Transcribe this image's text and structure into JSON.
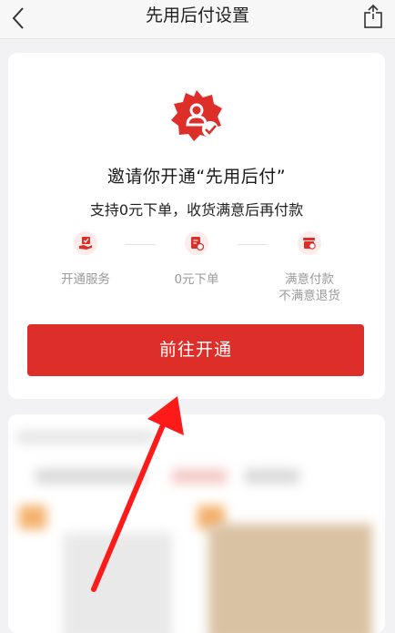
{
  "header": {
    "title": "先用后付设置",
    "back_icon": "chevron-left-icon",
    "share_icon": "share-icon"
  },
  "card": {
    "badge_icon": "user-verified-badge-icon",
    "headline": "邀请你开通“先用后付”",
    "subline": "支持0元下单，收货满意后再付款",
    "steps": [
      {
        "icon": "hand-check-icon",
        "label": "开通服务"
      },
      {
        "icon": "document-yuan-icon",
        "label": "0元下单"
      },
      {
        "icon": "wallet-yuan-icon",
        "label_line1": "满意付款",
        "label_line2": "不满意退货"
      }
    ],
    "cta_label": "前往开通"
  },
  "colors": {
    "accent": "#dd2e2a",
    "icon_bg": "#fdecea",
    "muted_text": "#9a9a9a",
    "page_bg": "#f2f2f4"
  }
}
